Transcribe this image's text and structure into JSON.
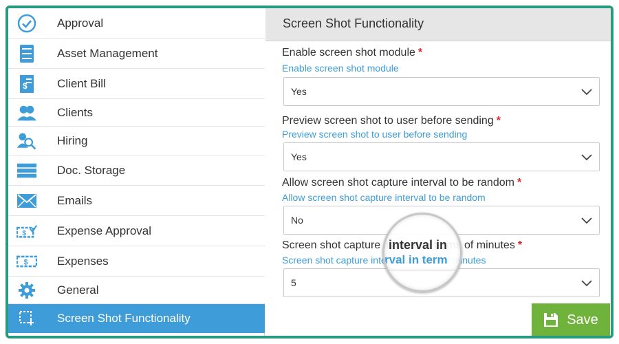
{
  "sidebar": {
    "items": [
      {
        "label": "Approval",
        "icon": "check-circle-icon"
      },
      {
        "label": "Asset Management",
        "icon": "cabinet-icon"
      },
      {
        "label": "Client Bill",
        "icon": "bill-icon"
      },
      {
        "label": "Clients",
        "icon": "users-icon"
      },
      {
        "label": "Hiring",
        "icon": "search-user-icon"
      },
      {
        "label": "Doc. Storage",
        "icon": "storage-icon"
      },
      {
        "label": "Emails",
        "icon": "envelope-icon"
      },
      {
        "label": "Expense Approval",
        "icon": "money-check-icon"
      },
      {
        "label": "Expenses",
        "icon": "money-icon"
      },
      {
        "label": "General",
        "icon": "gear-icon"
      },
      {
        "label": "Screen Shot Functionality",
        "icon": "screenshot-icon"
      }
    ],
    "active_index": 10
  },
  "main": {
    "title": "Screen Shot Functionality",
    "fields": [
      {
        "label": "Enable screen shot module",
        "required_mark": "*",
        "help": "Enable screen shot module",
        "value": "Yes"
      },
      {
        "label": "Preview screen shot to user before sending",
        "required_mark": "*",
        "help": "Preview screen shot to user before sending",
        "value": "Yes"
      },
      {
        "label": "Allow screen shot capture interval to be random",
        "required_mark": "*",
        "help": "Allow screen shot capture interval to be random",
        "value": "No"
      },
      {
        "label": "Screen shot capture interval in terms of minutes",
        "required_mark": "*",
        "help": "Screen shot capture interval in terms of minutes",
        "value": "5"
      }
    ],
    "save_label": "Save"
  },
  "magnifier": {
    "label_text": "interval in",
    "help_text": "rval in term"
  },
  "colors": {
    "frame": "#2a9a7e",
    "accent": "#3e9dd8",
    "save": "#6fb33c",
    "required": "#d9262b"
  }
}
